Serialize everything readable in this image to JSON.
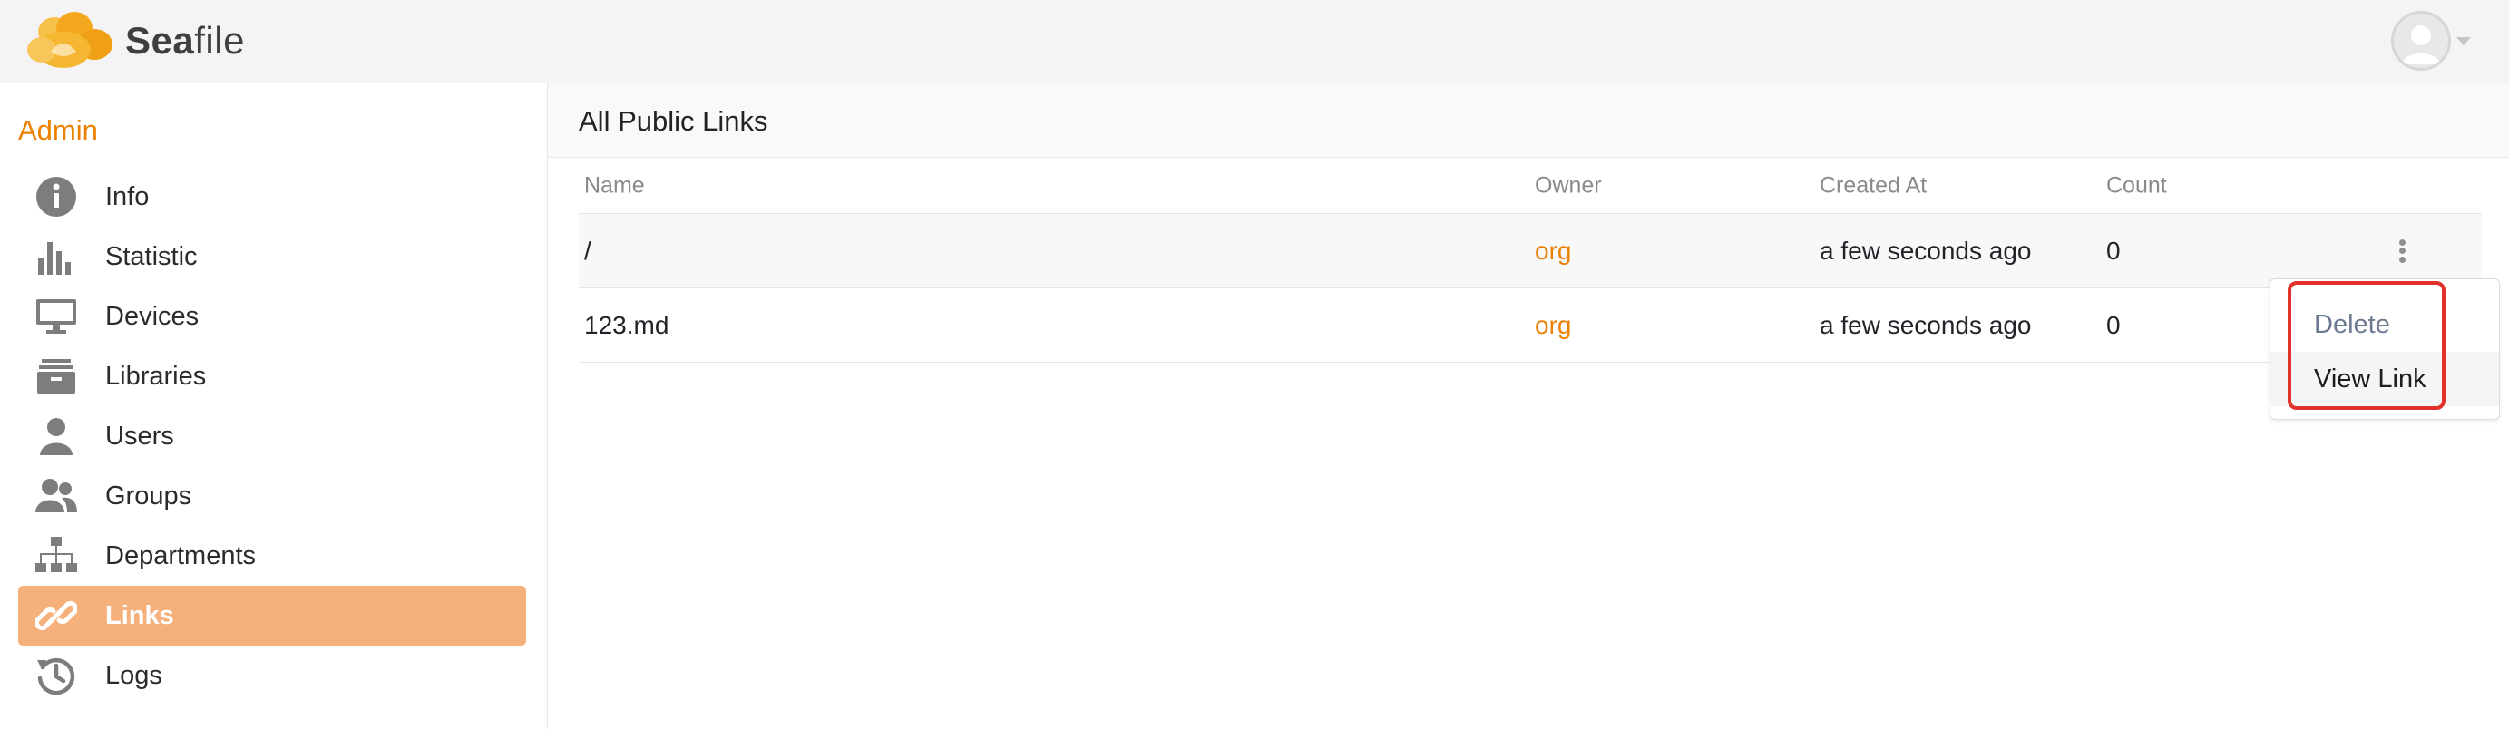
{
  "app": {
    "logo_text_bold": "Sea",
    "logo_text_rest": "file"
  },
  "sidebar": {
    "title": "Admin",
    "items": [
      {
        "label": "Info",
        "icon": "info-icon"
      },
      {
        "label": "Statistic",
        "icon": "bar-chart-icon"
      },
      {
        "label": "Devices",
        "icon": "monitor-icon"
      },
      {
        "label": "Libraries",
        "icon": "archive-box-icon"
      },
      {
        "label": "Users",
        "icon": "user-icon"
      },
      {
        "label": "Groups",
        "icon": "users-group-icon"
      },
      {
        "label": "Departments",
        "icon": "org-chart-icon"
      },
      {
        "label": "Links",
        "icon": "link-icon",
        "active": true
      },
      {
        "label": "Logs",
        "icon": "history-icon"
      }
    ]
  },
  "main": {
    "title": "All Public Links",
    "columns": {
      "name": "Name",
      "owner": "Owner",
      "created": "Created At",
      "count": "Count"
    },
    "rows": [
      {
        "name": "/",
        "owner": "org",
        "created": "a few seconds ago",
        "count": "0"
      },
      {
        "name": "123.md",
        "owner": "org",
        "created": "a few seconds ago",
        "count": "0"
      }
    ]
  },
  "menu": {
    "delete_label": "Delete",
    "view_label": "View Link"
  },
  "colors": {
    "accent": "#ec8000",
    "active_nav_bg": "#f5b07c",
    "highlight_border": "#e0322a"
  }
}
